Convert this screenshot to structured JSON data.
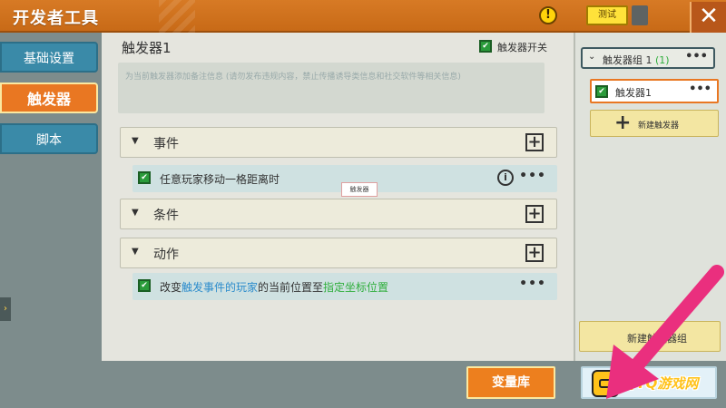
{
  "header": {
    "title": "开发者工具",
    "warning_icon": "exclamation-icon",
    "test_label": "测试",
    "close_icon": "close-icon"
  },
  "sidebar": {
    "items": [
      {
        "label": "基础设置"
      },
      {
        "label": "触发器",
        "active": true
      },
      {
        "label": "脚本"
      }
    ]
  },
  "main": {
    "trigger_name": "触发器1",
    "switch_label": "触发器开关",
    "switch_checked": true,
    "note_placeholder": "为当前触发器添加备注信息 (请勿发布违规内容，禁止传播诱导类信息和社交软件等相关信息)",
    "sections": {
      "event": {
        "label": "事件"
      },
      "condition": {
        "label": "条件"
      },
      "action": {
        "label": "动作"
      }
    },
    "event_row": {
      "text": "任意玩家移动一格距离时",
      "checked": true
    },
    "action_row": {
      "prefix": "改变",
      "highlight_1": "触发事件的玩家",
      "mid": "的当前位置至",
      "highlight_2": "指定坐标位置",
      "checked": true
    },
    "tooltip": "触发器"
  },
  "right_panel": {
    "group_name": "触发器组 1",
    "group_count": "(1)",
    "trigger_item": "触发器1",
    "new_trigger_label": "新建触发器",
    "new_group_label": "新建触发器组"
  },
  "bottom": {
    "var_label": "变量库"
  },
  "watermark": {
    "text": "QYQ游戏网"
  },
  "colors": {
    "header_orange": "#d77a25",
    "accent_orange": "#e97722",
    "sidebar_blue": "#3a8aa8",
    "check_green": "#2a9b3a",
    "highlight_blue": "#2c8ccc",
    "highlight_green": "#2fae3c",
    "arrow_pink": "#ea2f7e"
  }
}
